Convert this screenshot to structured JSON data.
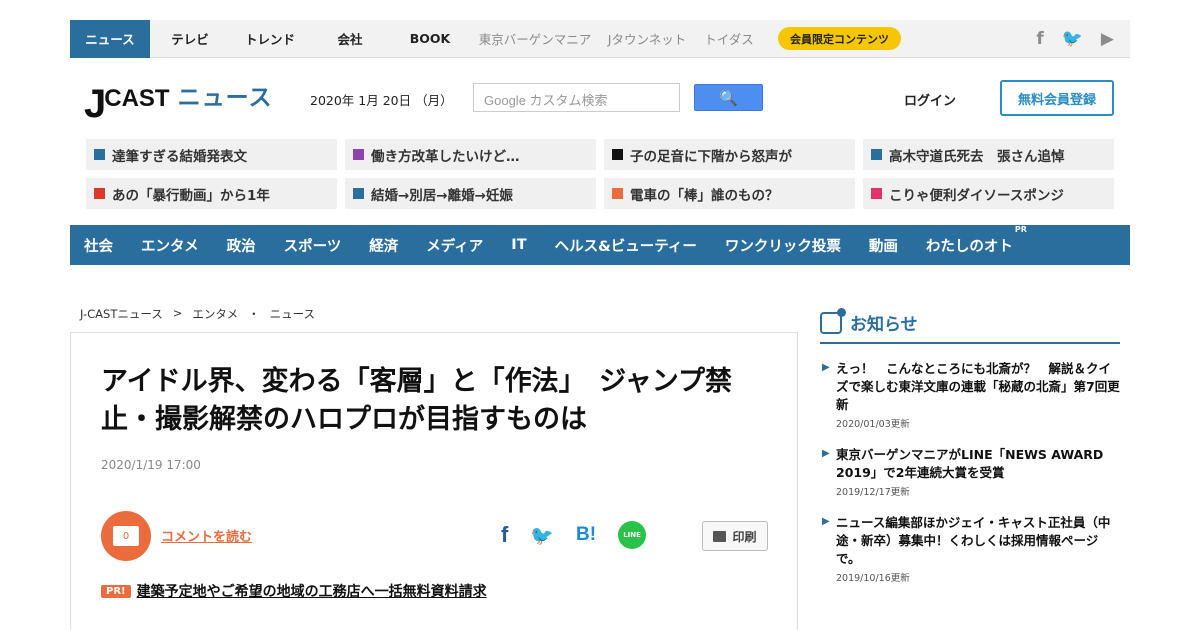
{
  "topnav": {
    "items": [
      "ニュース",
      "テレビ",
      "トレンド",
      "会社",
      "BOOK"
    ],
    "gray_items": [
      "東京バーゲンマニア",
      "Jタウンネット",
      "トイダス"
    ],
    "member_label": "会員限定コンテンツ",
    "social": {
      "facebook": "f",
      "twitter": "🐦",
      "youtube": "▶"
    }
  },
  "header": {
    "logo_j": "J",
    "logo_cast": "CAST",
    "logo_news": "ニュース",
    "date": "2020年 1月 20日 （月）",
    "search_placeholder": "Google カスタム検索",
    "search_button": "🔍",
    "login": "ログイン",
    "register": "無料会員登録"
  },
  "tags": [
    {
      "label": "達筆すぎる結婚発表文",
      "color": "#2a6e9e"
    },
    {
      "label": "働き方改革したいけど…",
      "color": "#8e44ad"
    },
    {
      "label": "子の足音に下階から怒声が",
      "color": "#111111"
    },
    {
      "label": "高木守道氏死去　張さん追悼",
      "color": "#2a6e9e"
    },
    {
      "label": "あの「暴行動画」から1年",
      "color": "#d93a2b"
    },
    {
      "label": "結婚→別居→離婚→妊娠",
      "color": "#2a6e9e"
    },
    {
      "label": "電車の「棒」誰のもの？",
      "color": "#ea6b3c"
    },
    {
      "label": "こりゃ便利ダイソースポンジ",
      "color": "#e0336a"
    }
  ],
  "catnav": {
    "items": [
      "社会",
      "エンタメ",
      "政治",
      "スポーツ",
      "経済",
      "メディア",
      "IT",
      "ヘルス&ビューティー",
      "ワンクリック投票",
      "動画",
      "わたしのオト"
    ],
    "pr_sup": "PR"
  },
  "breadcrumb": [
    "J-CASTニュース",
    ">",
    "エンタメ",
    "・",
    "ニュース"
  ],
  "article": {
    "headline": "アイドル界、変わる「客層」と「作法」　ジャンプ禁止・撮影解禁のハロプロが目指すものは",
    "pubdate": "2020/1/19 17:00",
    "comment_count": "0",
    "comment_link": "コメントを読む",
    "share_fb": "f",
    "share_tw": "🐦",
    "share_hb": "B!",
    "share_line": "LINE",
    "print_label": "印刷",
    "pr_badge": "PR!",
    "pr_text": "建築予定地やご希望の地域の工務店へ一括無料資料請求"
  },
  "notices": {
    "title": "お知らせ",
    "items": [
      {
        "text": "えっ！　こんなところにも北斎が？　解説＆クイズで楽しむ東洋文庫の連載「秘蔵の北斎」第7回更新",
        "meta": "2020/01/03更新"
      },
      {
        "text": "東京バーゲンマニアがLINE「NEWS AWARD 2019」で2年連続大賞を受賞",
        "meta": "2019/12/17更新"
      },
      {
        "text": "ニュース編集部ほかジェイ・キャスト正社員（中途・新卒）募集中！くわしくは採用情報ページで。",
        "meta": "2019/10/16更新"
      }
    ]
  }
}
